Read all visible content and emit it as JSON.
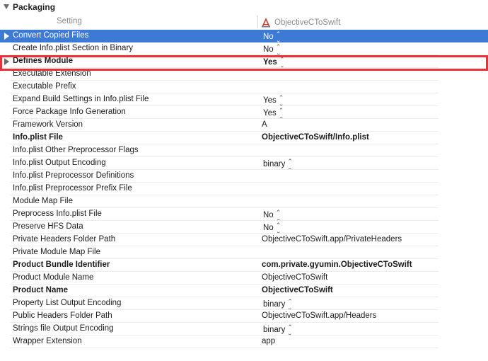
{
  "section": {
    "title": "Packaging"
  },
  "columns": {
    "setting": "Setting",
    "target": "ObjectiveCToSwift"
  },
  "colors": {
    "selection": "#3d7ad6",
    "highlight": "#e63238"
  },
  "rows": [
    {
      "label": "Convert Copied Files",
      "value": "No",
      "stepper": true,
      "bold": false,
      "expandable": true,
      "selected": true
    },
    {
      "label": "Create Info.plist Section in Binary",
      "value": "No",
      "stepper": true,
      "bold": false,
      "expandable": false,
      "selected": false
    },
    {
      "label": "Defines Module",
      "value": "Yes",
      "stepper": true,
      "bold": true,
      "expandable": true,
      "selected": false
    },
    {
      "label": "Executable Extension",
      "value": "",
      "stepper": false,
      "bold": false
    },
    {
      "label": "Executable Prefix",
      "value": "",
      "stepper": false,
      "bold": false
    },
    {
      "label": "Expand Build Settings in Info.plist File",
      "value": "Yes",
      "stepper": true,
      "bold": false
    },
    {
      "label": "Force Package Info Generation",
      "value": "Yes",
      "stepper": true,
      "bold": false
    },
    {
      "label": "Framework Version",
      "value": "A",
      "stepper": false,
      "bold": false
    },
    {
      "label": "Info.plist File",
      "value": "ObjectiveCToSwift/Info.plist",
      "stepper": false,
      "bold": true
    },
    {
      "label": "Info.plist Other Preprocessor Flags",
      "value": "",
      "stepper": false,
      "bold": false
    },
    {
      "label": "Info.plist Output Encoding",
      "value": "binary",
      "stepper": true,
      "bold": false
    },
    {
      "label": "Info.plist Preprocessor Definitions",
      "value": "",
      "stepper": false,
      "bold": false
    },
    {
      "label": "Info.plist Preprocessor Prefix File",
      "value": "",
      "stepper": false,
      "bold": false
    },
    {
      "label": "Module Map File",
      "value": "",
      "stepper": false,
      "bold": false
    },
    {
      "label": "Preprocess Info.plist File",
      "value": "No",
      "stepper": true,
      "bold": false
    },
    {
      "label": "Preserve HFS Data",
      "value": "No",
      "stepper": true,
      "bold": false
    },
    {
      "label": "Private Headers Folder Path",
      "value": "ObjectiveCToSwift.app/PrivateHeaders",
      "stepper": false,
      "bold": false
    },
    {
      "label": "Private Module Map File",
      "value": "",
      "stepper": false,
      "bold": false
    },
    {
      "label": "Product Bundle Identifier",
      "value": "com.private.gyumin.ObjectiveCToSwift",
      "stepper": false,
      "bold": true
    },
    {
      "label": "Product Module Name",
      "value": "ObjectiveCToSwift",
      "stepper": false,
      "bold": false
    },
    {
      "label": "Product Name",
      "value": "ObjectiveCToSwift",
      "stepper": false,
      "bold": true
    },
    {
      "label": "Property List Output Encoding",
      "value": "binary",
      "stepper": true,
      "bold": false
    },
    {
      "label": "Public Headers Folder Path",
      "value": "ObjectiveCToSwift.app/Headers",
      "stepper": false,
      "bold": false
    },
    {
      "label": "Strings file Output Encoding",
      "value": "binary",
      "stepper": true,
      "bold": false
    },
    {
      "label": "Wrapper Extension",
      "value": "app",
      "stepper": false,
      "bold": false
    }
  ]
}
